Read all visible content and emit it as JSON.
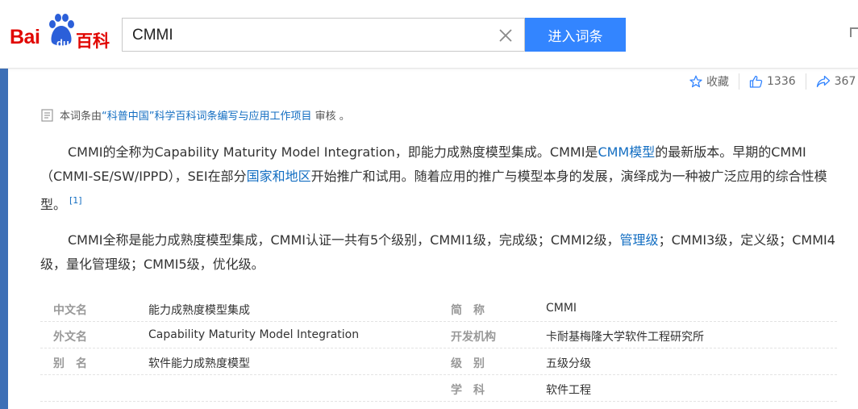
{
  "header": {
    "logo": {
      "bai": "Bai",
      "du": "du",
      "baike": "百科"
    },
    "search": {
      "value": "CMMI",
      "placeholder": ""
    },
    "search_button_label": "进入词条"
  },
  "actions": {
    "collect_label": "收藏",
    "like_count": "1336",
    "share_count": "367"
  },
  "review": {
    "prefix": "本词条由",
    "link_text": "“科普中国”科学百科词条编写与应用工作项目",
    "suffix": " 审核 。"
  },
  "summary": {
    "p1": {
      "t1": "CMMI的全称为Capability Maturity Model Integration，即能力成熟度模型集成。CMMI是",
      "link1": "CMM模型",
      "t2": "的最新版本。早期的CMMI（CMMI-SE/SW/IPPD），SEI在部分",
      "link2": "国家和地区",
      "t3": "开始推广和试用。随着应用的推广与模型本身的发展，演绎成为一种被广泛应用的综合性模型。",
      "ref": "[1]"
    },
    "p2": {
      "t1": "CMMI全称是能力成熟度模型集成，CMMI认证一共有5个级别，CMMI1级，完成级；CMMI2级，",
      "link1": "管理级",
      "t2": "；CMMI3级，定义级；CMMI4级，量化管理级；CMMI5级，优化级。"
    }
  },
  "info_table": {
    "rows": [
      {
        "l1": "中文名",
        "v1": "能力成熟度模型集成",
        "l2": "简　称",
        "v2": "CMMI"
      },
      {
        "l1": "外文名",
        "v1": "Capability Maturity Model Integration",
        "l2": "开发机构",
        "v2": "卡耐基梅隆大学软件工程研究所"
      },
      {
        "l1": "别　名",
        "v1": "软件能力成熟度模型",
        "l2": "级　别",
        "v2": "五级分级"
      },
      {
        "l1": "",
        "v1": "",
        "l2": "学　科",
        "v2": "软件工程"
      }
    ]
  },
  "colors": {
    "brand_red": "#e10601",
    "accent_blue": "#3385ff",
    "link_blue": "#136ec2"
  }
}
